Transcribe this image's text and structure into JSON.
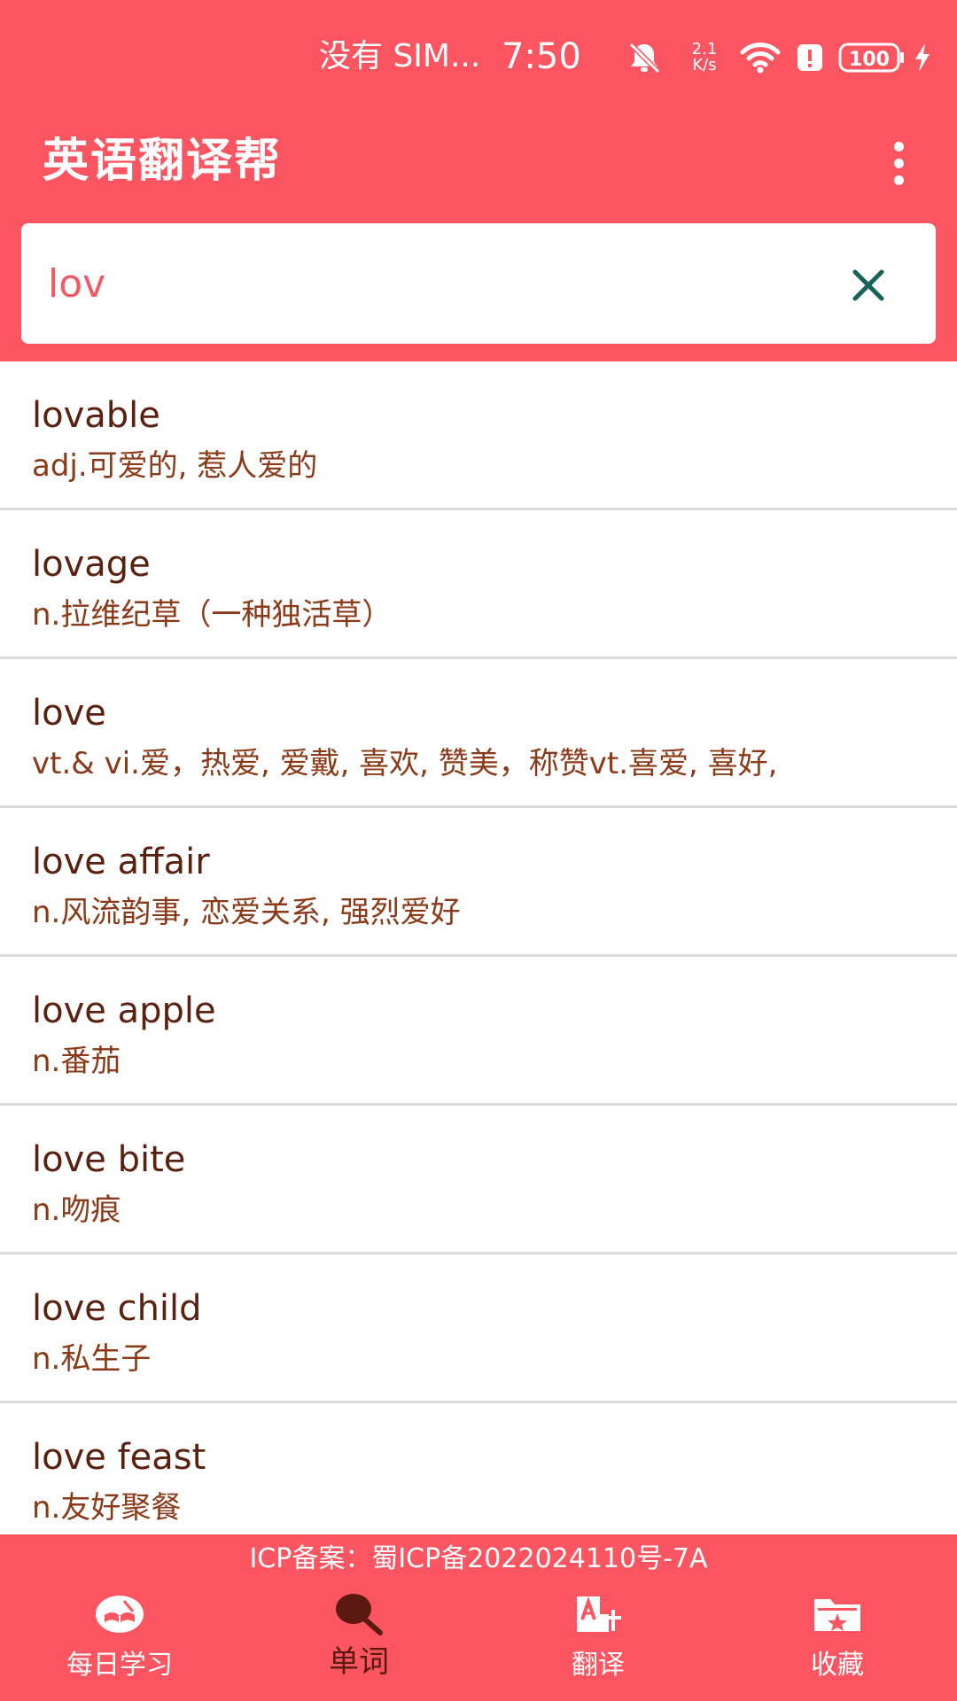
{
  "status_bar": {
    "carrier": "没有 SIM...",
    "time": "7:50",
    "net_speed_value": "2.1",
    "net_speed_unit": "K/s",
    "battery": "100",
    "icons": [
      "bell-muted-icon",
      "wifi-icon",
      "alert-icon",
      "battery-icon",
      "charging-bolt-icon"
    ]
  },
  "app_bar": {
    "title": "英语翻译帮",
    "menu_icon": "overflow-menu-icon"
  },
  "search": {
    "value": "lov",
    "clear_icon": "close-icon"
  },
  "word_list": [
    {
      "word": "lovable",
      "meaning": "adj.可爱的, 惹人爱的"
    },
    {
      "word": "lovage",
      "meaning": "n.拉维纪草（一种独活草）"
    },
    {
      "word": "love",
      "meaning": "vt.& vi.爱，热爱, 爱戴, 喜欢, 赞美，称赞vt.喜爱, 喜好,"
    },
    {
      "word": "love affair",
      "meaning": "n.风流韵事, 恋爱关系, 强烈爱好"
    },
    {
      "word": "love apple",
      "meaning": "n.番茄"
    },
    {
      "word": "love bite",
      "meaning": "n.吻痕"
    },
    {
      "word": "love child",
      "meaning": "n.私生子"
    },
    {
      "word": "love feast",
      "meaning": "n.友好聚餐"
    }
  ],
  "footer": {
    "icp": "ICP备案：蜀ICP备2022024110号-7A"
  },
  "bottom_nav": [
    {
      "label": "每日学习",
      "icon": "book-icon",
      "active": false
    },
    {
      "label": "单词",
      "icon": "search-icon",
      "active": true
    },
    {
      "label": "翻译",
      "icon": "translate-icon",
      "active": false
    },
    {
      "label": "收藏",
      "icon": "folder-star-icon",
      "active": false
    }
  ],
  "colors": {
    "brand": "#fa5560",
    "word_text": "#5a2010",
    "meaning_text": "#8a3a18",
    "clear_icon": "#17625a",
    "active_nav": "#5a1a12"
  }
}
